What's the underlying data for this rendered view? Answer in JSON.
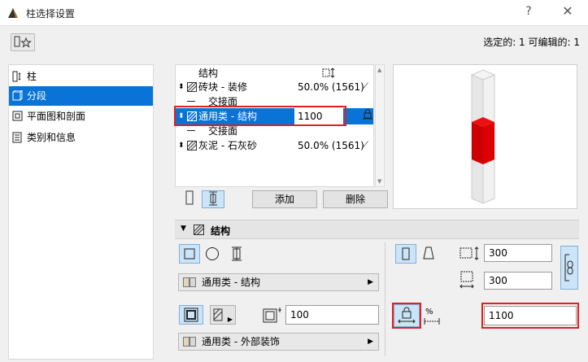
{
  "window": {
    "title": "柱选择设置",
    "help": "?",
    "close": "✕"
  },
  "selection_info": "选定的: 1 可编辑的: 1",
  "sidebar": {
    "items": [
      {
        "label": "柱",
        "icon": "column-icon"
      },
      {
        "label": "分段",
        "icon": "segments-icon",
        "selected": true
      },
      {
        "label": "平面图和剖面",
        "icon": "floor-plan-icon"
      },
      {
        "label": "类别和信息",
        "icon": "category-icon"
      }
    ]
  },
  "segment_list": {
    "header": {
      "structure": "结构"
    },
    "rows": [
      {
        "name": "砖块 - 装修",
        "value": "50.0% (1561)"
      },
      {
        "name": "交接面",
        "value": ""
      },
      {
        "name": "通用类 - 结构",
        "value": "1100"
      },
      {
        "name": "交接面",
        "value": ""
      },
      {
        "name": "灰泥 - 石灰砂",
        "value": "50.0% (1561)"
      }
    ]
  },
  "buttons": {
    "add": "添加",
    "delete": "删除"
  },
  "section": {
    "title": "结构"
  },
  "structure": {
    "material_top": "通用类 - 结构",
    "material_bottom": "通用类 - 外部装饰",
    "thickness": "100",
    "width": "300",
    "depth": "300",
    "height": "1100",
    "percent_symbol": "%"
  },
  "colors": {
    "accent": "#0a73d7",
    "highlight": "#e02020",
    "segment": "#dd0000"
  }
}
